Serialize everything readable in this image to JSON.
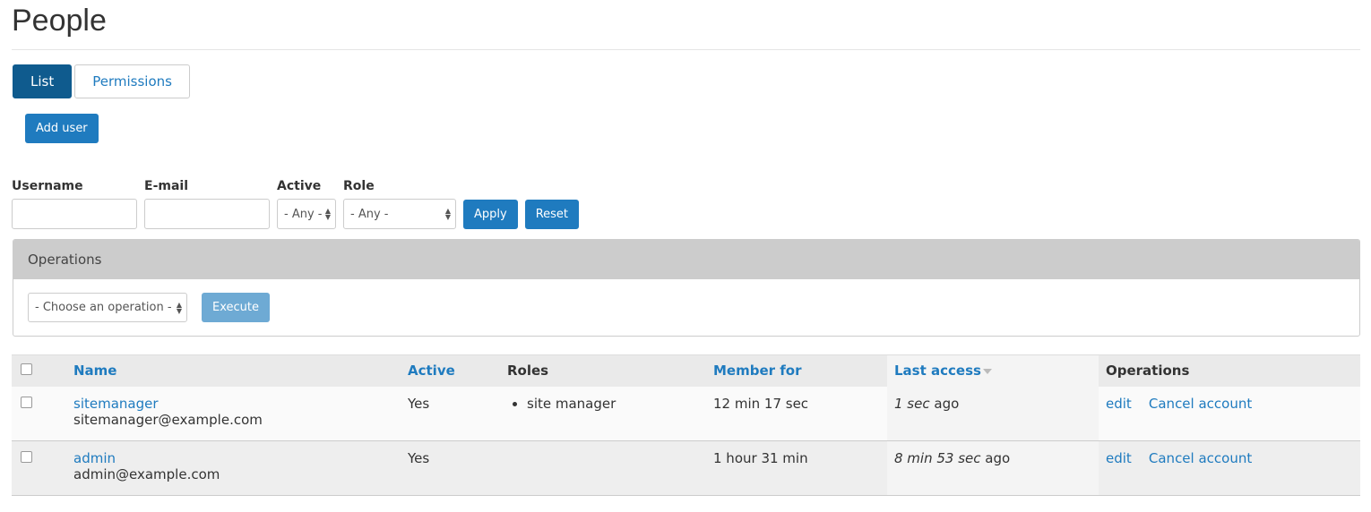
{
  "page": {
    "title": "People"
  },
  "tabs": [
    {
      "label": "List",
      "active": true
    },
    {
      "label": "Permissions",
      "active": false
    }
  ],
  "add_user_label": "Add user",
  "filters": {
    "username_label": "Username",
    "username_value": "",
    "email_label": "E-mail",
    "email_value": "",
    "active_label": "Active",
    "active_value": "- Any -",
    "role_label": "Role",
    "role_value": "- Any -",
    "apply_label": "Apply",
    "reset_label": "Reset"
  },
  "operations": {
    "title": "Operations",
    "select_value": "- Choose an operation -",
    "execute_label": "Execute"
  },
  "table": {
    "headers": {
      "name": "Name",
      "active": "Active",
      "roles": "Roles",
      "member_for": "Member for",
      "last_access": "Last access",
      "operations": "Operations"
    },
    "rows": [
      {
        "name": "sitemanager",
        "email": "sitemanager@example.com",
        "active": "Yes",
        "roles": [
          "site manager"
        ],
        "member_for": "12 min 17 sec",
        "last_access_em": "1 sec",
        "last_access_suffix": "ago",
        "edit": "edit",
        "cancel": "Cancel account"
      },
      {
        "name": "admin",
        "email": "admin@example.com",
        "active": "Yes",
        "roles": [],
        "member_for": "1 hour 31 min",
        "last_access_em": "8 min 53 sec",
        "last_access_suffix": "ago",
        "edit": "edit",
        "cancel": "Cancel account"
      }
    ]
  },
  "colors": {
    "accent": "#1f7bbf",
    "active_tab": "#0f5b8e",
    "execute_disabled": "#6eaad4"
  }
}
